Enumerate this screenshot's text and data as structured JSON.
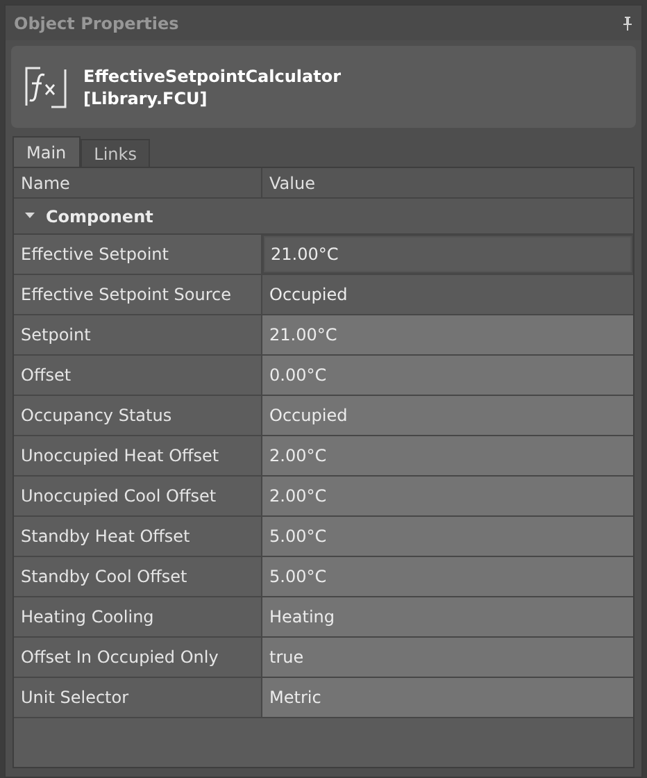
{
  "panel": {
    "title": "Object Properties"
  },
  "object": {
    "name": "EffectiveSetpointCalculator",
    "library": "[Library.FCU]"
  },
  "tabs": [
    {
      "label": "Main",
      "selected": true
    },
    {
      "label": "Links",
      "selected": false
    }
  ],
  "table": {
    "columns": [
      "Name",
      "Value"
    ],
    "group": {
      "label": "Component",
      "expanded": true
    },
    "rows": [
      {
        "name": "Effective Setpoint",
        "value": "21.00°C",
        "read_only": true,
        "selected": true
      },
      {
        "name": "Effective Setpoint Source",
        "value": "Occupied",
        "read_only": true,
        "selected": false
      },
      {
        "name": "Setpoint",
        "value": "21.00°C",
        "read_only": false,
        "selected": false
      },
      {
        "name": "Offset",
        "value": "0.00°C",
        "read_only": false,
        "selected": false
      },
      {
        "name": "Occupancy Status",
        "value": "Occupied",
        "read_only": false,
        "selected": false
      },
      {
        "name": "Unoccupied Heat Offset",
        "value": "2.00°C",
        "read_only": false,
        "selected": false
      },
      {
        "name": "Unoccupied Cool Offset",
        "value": "2.00°C",
        "read_only": false,
        "selected": false
      },
      {
        "name": "Standby Heat Offset",
        "value": "5.00°C",
        "read_only": false,
        "selected": false
      },
      {
        "name": "Standby Cool Offset",
        "value": "5.00°C",
        "read_only": false,
        "selected": false
      },
      {
        "name": "Heating Cooling",
        "value": "Heating",
        "read_only": false,
        "selected": false
      },
      {
        "name": "Offset In Occupied Only",
        "value": "true",
        "read_only": false,
        "selected": false
      },
      {
        "name": "Unit Selector",
        "value": "Metric",
        "read_only": false,
        "selected": false
      }
    ]
  }
}
